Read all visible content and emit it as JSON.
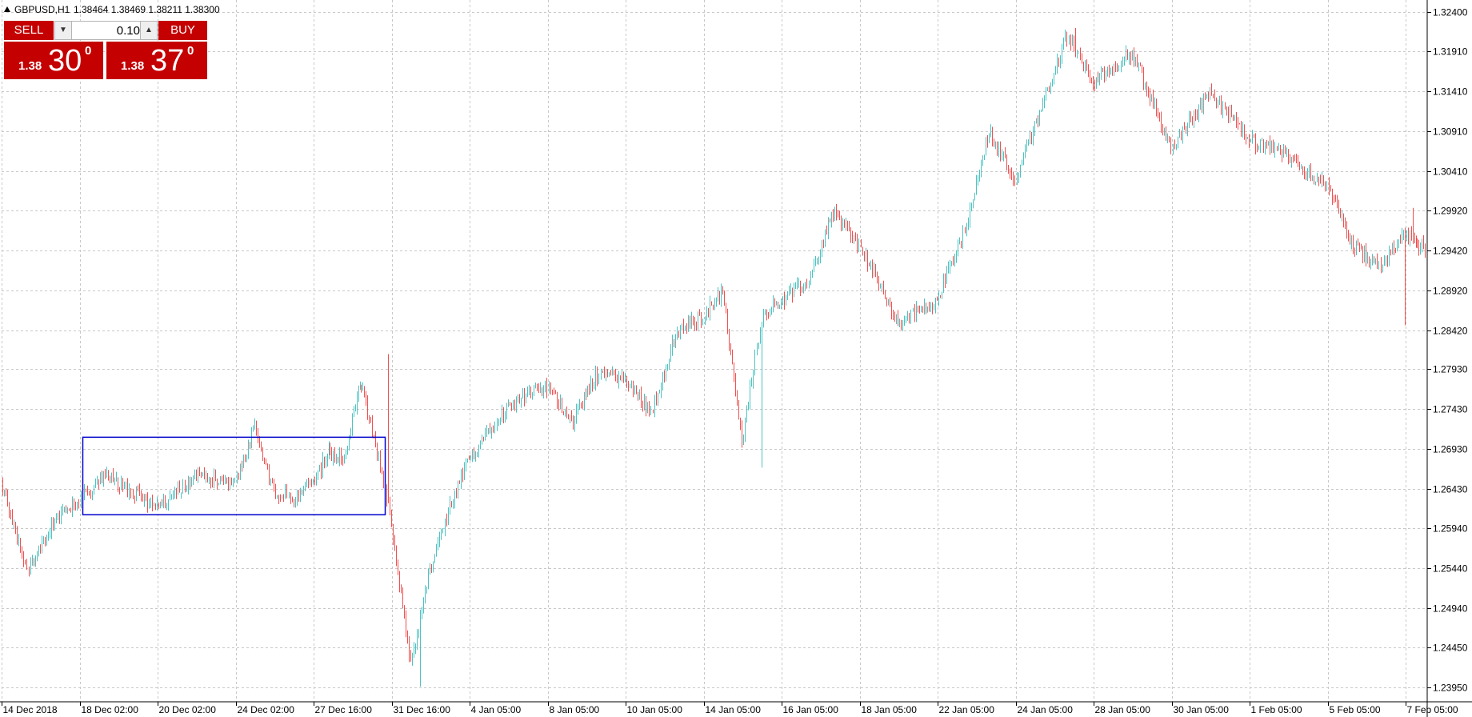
{
  "chart_header": {
    "symbol_label": "GBPUSD,H1",
    "ohlc": "1.38464 1.38469 1.38211 1.38300"
  },
  "one_click": {
    "sell_label": "SELL",
    "buy_label": "BUY",
    "lot": "0.10",
    "sell_price_prefix": "1.38",
    "sell_price_main": "30",
    "sell_price_sup": "0",
    "buy_price_prefix": "1.38",
    "buy_price_main": "37",
    "buy_price_sup": "0"
  },
  "colors": {
    "bull": "#4fc1c1",
    "bear": "#f05050",
    "grid": "#c8c8c8",
    "highlight_box": "#0000cc",
    "button": "#c40000"
  },
  "chart_data": {
    "type": "candlestick",
    "title": "",
    "y_axis_ticks": [
      1.324,
      1.3191,
      1.3141,
      1.3091,
      1.3041,
      1.2992,
      1.2942,
      1.2892,
      1.2842,
      1.2793,
      1.2743,
      1.2693,
      1.2643,
      1.2594,
      1.2544,
      1.2494,
      1.2445,
      1.2395
    ],
    "ylim": [
      1.2377,
      1.3255
    ],
    "x_axis_ticks": [
      "14 Dec 2018",
      "18 Dec 02:00",
      "20 Dec 02:00",
      "24 Dec 02:00",
      "27 Dec 16:00",
      "31 Dec 16:00",
      "4 Jan 05:00",
      "8 Jan 05:00",
      "10 Jan 05:00",
      "14 Jan 05:00",
      "16 Jan 05:00",
      "18 Jan 05:00",
      "22 Jan 05:00",
      "24 Jan 05:00",
      "28 Jan 05:00",
      "30 Jan 05:00",
      "1 Feb 05:00",
      "5 Feb 05:00",
      "7 Feb 05:00"
    ],
    "grid": true,
    "highlight_range": {
      "start": "18 Dec 02:00",
      "end": "31 Dec 16:00",
      "price_low": 1.2611,
      "price_high": 1.2708
    },
    "path_points": [
      {
        "at": "14 Dec 2018",
        "price": 1.265
      },
      {
        "at": "15 Dec",
        "price": 1.254
      },
      {
        "at": "17 Dec",
        "price": 1.26
      },
      {
        "at": "18 Dec 02:00",
        "price": 1.263
      },
      {
        "at": "18 Dec",
        "price": 1.266
      },
      {
        "at": "19 Dec",
        "price": 1.264
      },
      {
        "at": "20 Dec 02:00",
        "price": 1.262
      },
      {
        "at": "21 Dec",
        "price": 1.266
      },
      {
        "at": "24 Dec 02:00",
        "price": 1.265
      },
      {
        "at": "24 Dec",
        "price": 1.272
      },
      {
        "at": "26 Dec",
        "price": 1.264
      },
      {
        "at": "27 Dec",
        "price": 1.263
      },
      {
        "at": "27 Dec 16:00",
        "price": 1.265
      },
      {
        "at": "28 Dec",
        "price": 1.269
      },
      {
        "at": "30 Dec",
        "price": 1.268
      },
      {
        "at": "31 Dec",
        "price": 1.278
      },
      {
        "at": "31 Dec 12:00",
        "price": 1.27
      },
      {
        "at": "31 Dec 16:00",
        "price": 1.26
      },
      {
        "at": "2 Jan 03:00",
        "price": 1.242
      },
      {
        "at": "2 Jan 06:00",
        "price": 1.254
      },
      {
        "at": "3 Jan",
        "price": 1.262
      },
      {
        "at": "4 Jan 05:00",
        "price": 1.268
      },
      {
        "at": "4 Jan 12:00",
        "price": 1.273
      },
      {
        "at": "7 Jan",
        "price": 1.276
      },
      {
        "at": "8 Jan 05:00",
        "price": 1.277
      },
      {
        "at": "9 Jan",
        "price": 1.273
      },
      {
        "at": "10 Jan",
        "price": 1.279
      },
      {
        "at": "10 Jan 05:00",
        "price": 1.278
      },
      {
        "at": "11 Jan",
        "price": 1.274
      },
      {
        "at": "14 Jan",
        "price": 1.284
      },
      {
        "at": "14 Jan 05:00",
        "price": 1.286
      },
      {
        "at": "15 Jan",
        "price": 1.289
      },
      {
        "at": "15 Jan 18:00",
        "price": 1.27
      },
      {
        "at": "16 Jan",
        "price": 1.286
      },
      {
        "at": "16 Jan 05:00",
        "price": 1.288
      },
      {
        "at": "17 Jan",
        "price": 1.29
      },
      {
        "at": "18 Jan",
        "price": 1.299
      },
      {
        "at": "18 Jan 05:00",
        "price": 1.295
      },
      {
        "at": "21 Jan",
        "price": 1.285
      },
      {
        "at": "22 Jan 05:00",
        "price": 1.288
      },
      {
        "at": "23 Jan",
        "price": 1.296
      },
      {
        "at": "24 Jan",
        "price": 1.309
      },
      {
        "at": "24 Jan 05:00",
        "price": 1.303
      },
      {
        "at": "25 Jan",
        "price": 1.312
      },
      {
        "at": "27 Jan",
        "price": 1.321
      },
      {
        "at": "28 Jan 05:00",
        "price": 1.315
      },
      {
        "at": "29 Jan",
        "price": 1.319
      },
      {
        "at": "30 Jan 05:00",
        "price": 1.307
      },
      {
        "at": "31 Jan",
        "price": 1.314
      },
      {
        "at": "1 Feb 05:00",
        "price": 1.308
      },
      {
        "at": "4 Feb",
        "price": 1.306
      },
      {
        "at": "5 Feb 05:00",
        "price": 1.302
      },
      {
        "at": "6 Feb",
        "price": 1.295
      },
      {
        "at": "7 Feb",
        "price": 1.292
      },
      {
        "at": "7 Feb 05:00",
        "price": 1.296
      },
      {
        "at": "8 Feb",
        "price": 1.2945
      }
    ]
  }
}
